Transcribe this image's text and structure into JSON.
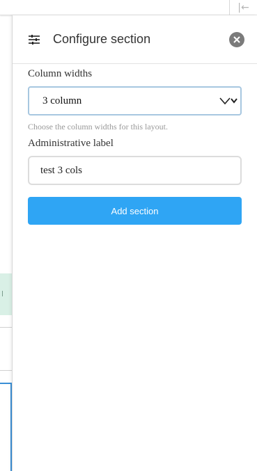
{
  "panel": {
    "title": "Configure section",
    "header_icon": "sliders-icon",
    "close_icon": "close-icon"
  },
  "form": {
    "column_widths": {
      "label": "Column widths",
      "value": "3 column",
      "description": "Choose the column widths for this layout."
    },
    "admin_label": {
      "label": "Administrative label",
      "value": "test 3 cols"
    },
    "submit_label": "Add section"
  },
  "background": {
    "collapse_icon": "collapse-panel-icon"
  },
  "colors": {
    "accent": "#2fa5f4",
    "close_bg": "#7b7b7b",
    "select_border": "#a7c7e0"
  }
}
